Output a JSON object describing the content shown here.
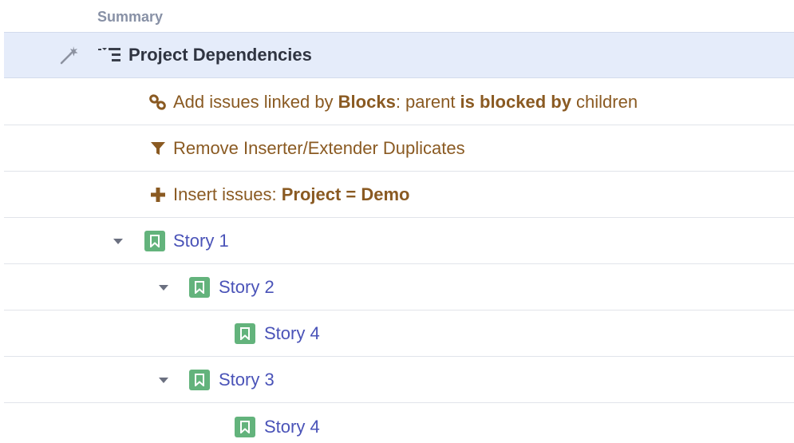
{
  "header": {
    "column_title": "Summary"
  },
  "structure": {
    "title": "Project Dependencies",
    "generators": [
      {
        "type": "extender",
        "icon": "link-icon",
        "parts": [
          "Add issues linked by ",
          "Blocks",
          ": parent ",
          "is blocked by",
          " children"
        ]
      },
      {
        "type": "filter",
        "icon": "filter-icon",
        "parts": [
          "Remove Inserter/Extender Duplicates"
        ]
      },
      {
        "type": "inserter",
        "icon": "plus-icon",
        "parts": [
          "Insert issues: ",
          "Project = Demo"
        ]
      }
    ],
    "issues": [
      {
        "label": "Story 1",
        "level": 0,
        "expanded": true,
        "icon": "story-bookmark-icon"
      },
      {
        "label": "Story 2",
        "level": 1,
        "expanded": true,
        "icon": "story-bookmark-icon"
      },
      {
        "label": "Story 4",
        "level": 2,
        "expanded": false,
        "icon": "story-bookmark-icon"
      },
      {
        "label": "Story 3",
        "level": 1,
        "expanded": true,
        "icon": "story-bookmark-icon"
      },
      {
        "label": "Story 4",
        "level": 2,
        "expanded": false,
        "icon": "story-bookmark-icon"
      }
    ]
  },
  "colors": {
    "selected_row_bg": "#e5ecfa",
    "generator_text": "#8a5a22",
    "issue_link": "#4a53b8",
    "story_icon": "#63b37c",
    "header_text": "#8891a6"
  }
}
